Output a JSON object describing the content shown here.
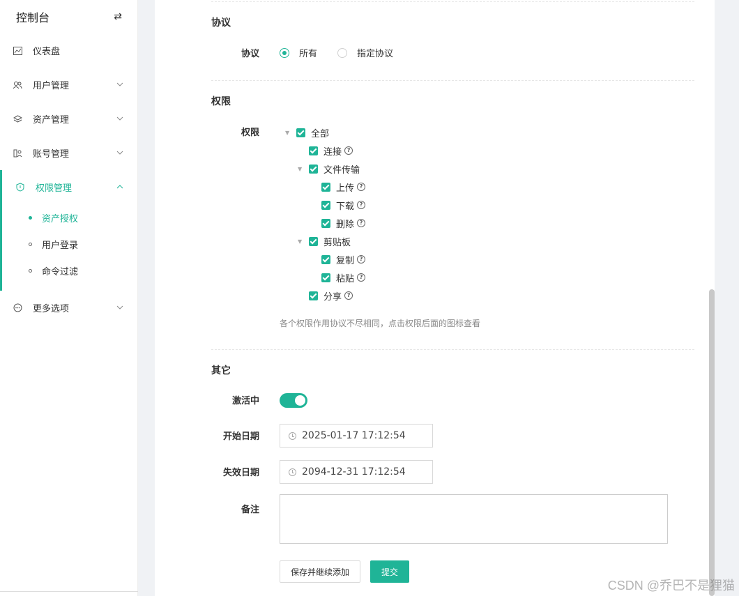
{
  "sidebar": {
    "title": "控制台",
    "items": [
      {
        "label": "仪表盘"
      },
      {
        "label": "用户管理"
      },
      {
        "label": "资产管理"
      },
      {
        "label": "账号管理"
      },
      {
        "label": "权限管理"
      },
      {
        "label": "更多选项"
      }
    ],
    "sub_items": [
      {
        "label": "资产授权"
      },
      {
        "label": "用户登录"
      },
      {
        "label": "命令过滤"
      }
    ]
  },
  "form": {
    "protocol_section": "协议",
    "protocol_label": "协议",
    "protocol_options": [
      "所有",
      "指定协议"
    ],
    "permission_section": "权限",
    "permission_label": "权限",
    "tree": {
      "all": "全部",
      "connect": "连接",
      "file_transfer": "文件传输",
      "upload": "上传",
      "download": "下载",
      "delete": "删除",
      "clipboard": "剪贴板",
      "copy": "复制",
      "paste": "粘贴",
      "share": "分享"
    },
    "permission_hint": "各个权限作用协议不尽相同，点击权限后面的图标查看",
    "other_section": "其它",
    "active_label": "激活中",
    "start_label": "开始日期",
    "start_value": "2025-01-17 17:12:54",
    "end_label": "失效日期",
    "end_value": "2094-12-31 17:12:54",
    "remark_label": "备注",
    "save_continue": "保存并继续添加",
    "submit": "提交"
  },
  "watermark": "CSDN @乔巴不是狸猫",
  "colors": {
    "accent": "#1fb497"
  }
}
